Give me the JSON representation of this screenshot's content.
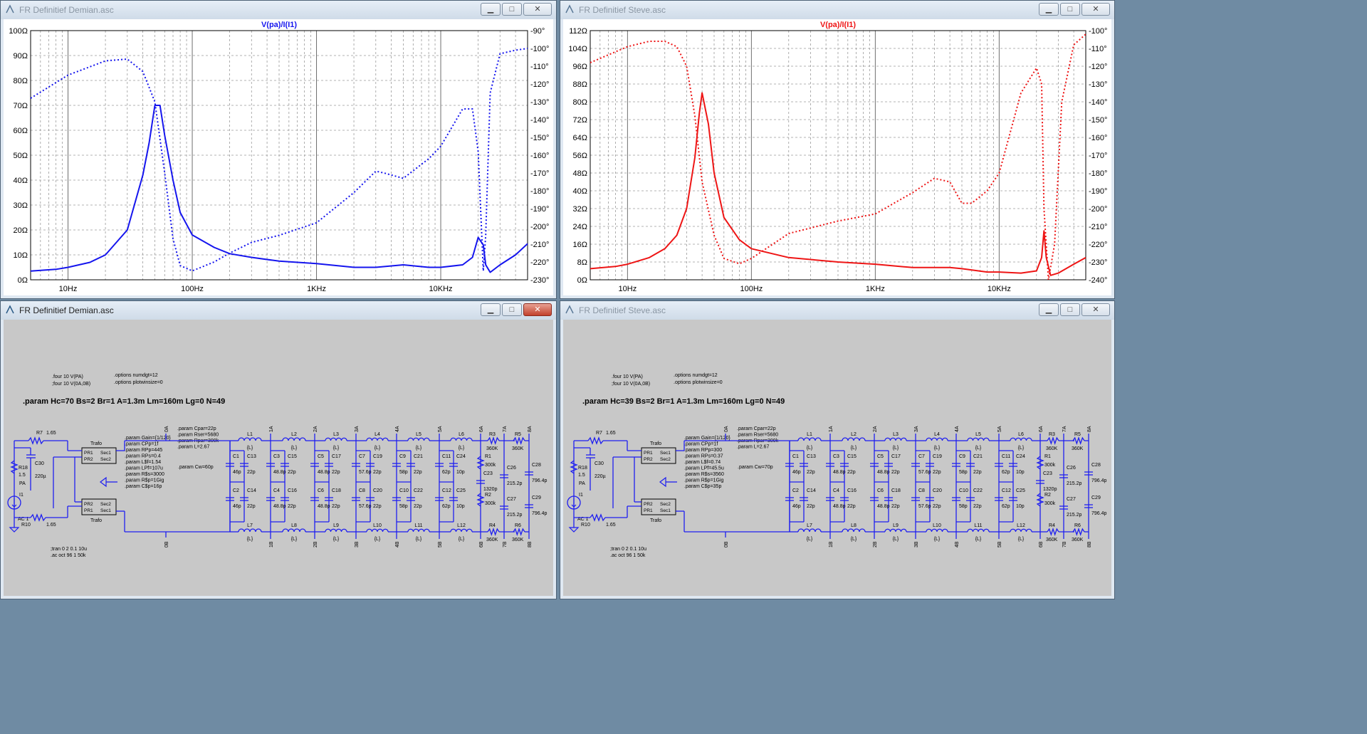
{
  "windows": [
    {
      "id": "plot-demian",
      "title": "FR Definitief Demian.asc",
      "active": false,
      "trace_label": "V(pa)/I(I1)",
      "color": "#1515ee",
      "x_ticks": [
        "10Hz",
        "100Hz",
        "1KHz",
        "10KHz"
      ],
      "left_ticks": [
        "100Ω",
        "90Ω",
        "80Ω",
        "70Ω",
        "60Ω",
        "50Ω",
        "40Ω",
        "30Ω",
        "20Ω",
        "10Ω",
        "0Ω"
      ],
      "right_ticks": [
        "-90°",
        "-100°",
        "-110°",
        "-120°",
        "-130°",
        "-140°",
        "-150°",
        "-160°",
        "-170°",
        "-180°",
        "-190°",
        "-200°",
        "-210°",
        "-220°",
        "-230°"
      ]
    },
    {
      "id": "plot-steve",
      "title": "FR Definitief Steve.asc",
      "active": false,
      "trace_label": "V(pa)/I(I1)",
      "color": "#ee1515",
      "x_ticks": [
        "10Hz",
        "100Hz",
        "1KHz",
        "10KHz"
      ],
      "left_ticks": [
        "112Ω",
        "104Ω",
        "96Ω",
        "88Ω",
        "80Ω",
        "72Ω",
        "64Ω",
        "56Ω",
        "48Ω",
        "40Ω",
        "32Ω",
        "24Ω",
        "16Ω",
        "8Ω",
        "0Ω"
      ],
      "right_ticks": [
        "-100°",
        "-110°",
        "-120°",
        "-130°",
        "-140°",
        "-150°",
        "-160°",
        "-170°",
        "-180°",
        "-190°",
        "-200°",
        "-210°",
        "-220°",
        "-230°",
        "-240°"
      ]
    },
    {
      "id": "sch-demian",
      "title": "FR Definitief Demian.asc",
      "active": true,
      "directives": {
        "four": ".four 10 V(PA)",
        "four_comment": ";four 10 V(0A,0B)",
        "options1": ".options numdgt=12",
        "options2": ".options plotwinsize=0",
        "param_main": ".param Hc=70 Bs=2 Br=1 A=1.3m Lm=160m Lg=0 N=49",
        "params_left": [
          ".param Gain={1/120}",
          ".param CPp=1f",
          ".param RPp=445",
          ".param RPs=0.4",
          ".param L$f=1.54",
          ".param LPf=107u",
          ".param R$s=3000",
          ".param R$p=1Gig",
          ".param C$p=16p"
        ],
        "params_right": [
          ".param Cpar=22p",
          ".param Rser=5680",
          ".param Rpar=300k",
          ".param L=2.67"
        ],
        "param_cw": ".param Cw=60p",
        "tran": ";tran 0 2 0.1 10u",
        "ac": ".ac oct 96 1 50k"
      },
      "parts": {
        "c1": "46p",
        "c2": "46p",
        "c3": "48.8p",
        "c4": "48.8p",
        "c5": "48.8p",
        "c6": "48.8p",
        "c7": "57.6p",
        "c8": "57.6p",
        "c9": "58p",
        "c10": "58p",
        "c11": "62p",
        "c12": "62p",
        "c24": "10p",
        "c25": "10p",
        "c23": "1320p",
        "c26": "215.2p",
        "c27": "215.2p",
        "c28": "796.4p",
        "c29": "796.4p",
        "r1": "300k",
        "r2": "300k",
        "r3": "360K",
        "r4": "360K",
        "r5": "360K",
        "r6": "360K"
      }
    },
    {
      "id": "sch-steve",
      "title": "FR Definitief Steve.asc",
      "active": false,
      "directives": {
        "four": ".four 10 V(PA)",
        "four_comment": ";four 10 V(0A,0B)",
        "options1": ".options numdgt=12",
        "options2": ".options plotwinsize=0",
        "param_main": ".param Hc=39 Bs=2 Br=1 A=1.3m Lm=160m Lg=0 N=49",
        "params_left": [
          ".param Gain={1/120}",
          ".param CPp=1f",
          ".param RPp=300",
          ".param RPs=0.37",
          ".param L$f=0.74",
          ".param LPf=45.5u",
          ".param R$s=3560",
          ".param R$p=1Gig",
          ".param C$p=35p"
        ],
        "params_right": [
          ".param Cpar=22p",
          ".param Rser=5680",
          ".param Rpar=300k",
          ".param L=2.67"
        ],
        "param_cw": ".param Cw=70p",
        "tran": ";tran 0 2 0.1 10u",
        "ac": ".ac oct 96 1 50k"
      },
      "parts": {
        "c1": "46p",
        "c2": "46p",
        "c3": "48.8p",
        "c4": "48.8p",
        "c5": "48.8p",
        "c6": "48.8p",
        "c7": "57.6p",
        "c8": "57.6p",
        "c9": "58p",
        "c10": "58p",
        "c11": "62p",
        "c12": "62p",
        "c24": "10p",
        "c25": "10p",
        "c23": "1320p",
        "c26": "215.2p",
        "c27": "215.2p",
        "c28": "796.4p",
        "c29": "796.4p",
        "r1": "300k",
        "r2": "300k",
        "r3": "360K",
        "r4": "360K",
        "r5": "360K",
        "r6": "360K"
      }
    }
  ],
  "schematic_labels": {
    "r7": "R7",
    "r7v": "1.65",
    "r10": "R10",
    "r10v": "1.65",
    "r18": "R18",
    "r18v": "1.5",
    "c30": "C30",
    "c30v": "220µ",
    "pa": "PA",
    "i1": "I1",
    "ac1": "AC 1",
    "trafo": "Trafo",
    "pr1": "PR1",
    "pr2": "PR2",
    "sec1": "Sec1",
    "sec2": "Sec2",
    "inductor_value": "{L}",
    "nodes_top": [
      "0A",
      "1A",
      "2A",
      "3A",
      "4A",
      "5A",
      "6A",
      "7A",
      "8A"
    ],
    "nodes_bottom": [
      "0B",
      "1B",
      "2B",
      "3B",
      "4B",
      "5B",
      "6B",
      "7B",
      "8B"
    ],
    "cpar_value": "22p"
  },
  "chart_data": [
    {
      "type": "line",
      "title": "V(pa)/I(I1)",
      "x_scale": "log",
      "xlim_hz": [
        5,
        50000
      ],
      "y_left_lim_ohm": [
        0,
        100
      ],
      "y_right_lim_deg": [
        -230,
        -90
      ],
      "grid": true,
      "series": [
        {
          "name": "V(pa)/I(I1)",
          "style": "solid",
          "axis": "left",
          "x": [
            5,
            8,
            10,
            15,
            20,
            30,
            40,
            45,
            50,
            55,
            60,
            70,
            80,
            100,
            150,
            200,
            300,
            500,
            1000,
            2000,
            3000,
            5000,
            8000,
            10000,
            15000,
            18000,
            20000,
            22000,
            23000,
            25000,
            30000,
            40000,
            50000
          ],
          "y": [
            3.5,
            4.2,
            5,
            7,
            10,
            20,
            42,
            55,
            70,
            70,
            58,
            40,
            27,
            18,
            13,
            10.5,
            9,
            7.5,
            6.5,
            5,
            5,
            6,
            5,
            5,
            6,
            9,
            17,
            14,
            6,
            3,
            6,
            10,
            14.5
          ]
        },
        {
          "name": "phase",
          "style": "dotted",
          "axis": "right",
          "x": [
            5,
            10,
            20,
            30,
            40,
            50,
            60,
            70,
            80,
            100,
            150,
            200,
            300,
            500,
            1000,
            2000,
            3000,
            3500,
            5000,
            8000,
            10000,
            15000,
            18000,
            20000,
            22000,
            23000,
            25000,
            30000,
            40000,
            50000
          ],
          "y": [
            -128,
            -115,
            -107,
            -106,
            -113,
            -130,
            -170,
            -207,
            -222,
            -225,
            -220,
            -215,
            -209,
            -205,
            -198,
            -181,
            -169,
            -170,
            -173,
            -162,
            -155,
            -134,
            -134,
            -158,
            -225,
            -205,
            -125,
            -103,
            -101,
            -100
          ]
        }
      ]
    },
    {
      "type": "line",
      "title": "V(pa)/I(I1)",
      "x_scale": "log",
      "xlim_hz": [
        5,
        50000
      ],
      "y_left_lim_ohm": [
        0,
        112
      ],
      "y_right_lim_deg": [
        -240,
        -100
      ],
      "grid": true,
      "series": [
        {
          "name": "V(pa)/I(I1)",
          "style": "solid",
          "axis": "left",
          "x": [
            5,
            8,
            10,
            15,
            20,
            25,
            30,
            35,
            38,
            40,
            45,
            50,
            60,
            80,
            100,
            200,
            500,
            1000,
            2000,
            4000,
            5000,
            8000,
            10000,
            15000,
            20000,
            22000,
            23000,
            24000,
            26000,
            30000,
            40000,
            50000
          ],
          "y": [
            5,
            6,
            7,
            10,
            14,
            20,
            32,
            55,
            75,
            84,
            70,
            48,
            28,
            18,
            14,
            10,
            8,
            7,
            5.5,
            5.5,
            5,
            3.5,
            3.5,
            3,
            4,
            10,
            22,
            10,
            2,
            3,
            7,
            10
          ]
        },
        {
          "name": "phase",
          "style": "dotted",
          "axis": "right",
          "x": [
            5,
            10,
            15,
            20,
            25,
            30,
            35,
            40,
            50,
            60,
            80,
            100,
            200,
            500,
            1000,
            2000,
            3000,
            4000,
            5000,
            6000,
            8000,
            10000,
            15000,
            20000,
            22000,
            23000,
            25000,
            28000,
            32000,
            40000,
            50000
          ],
          "y": [
            -118,
            -109,
            -106,
            -106,
            -109,
            -120,
            -148,
            -185,
            -215,
            -228,
            -231,
            -228,
            -214,
            -207,
            -203,
            -191,
            -183,
            -185,
            -197,
            -197,
            -190,
            -180,
            -135,
            -121,
            -130,
            -200,
            -240,
            -220,
            -140,
            -108,
            -102
          ]
        }
      ]
    }
  ]
}
